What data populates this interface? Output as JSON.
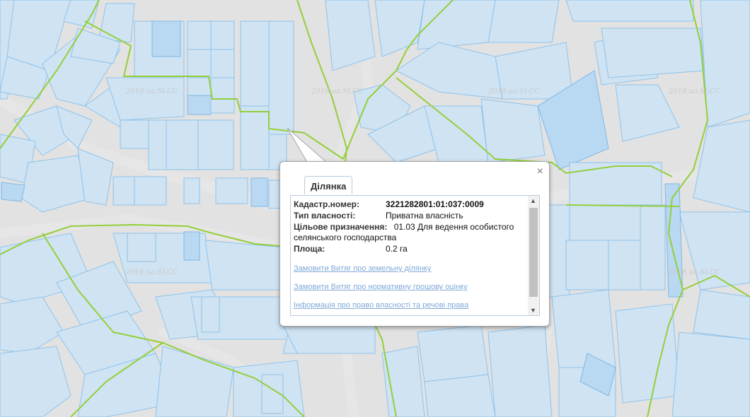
{
  "map": {
    "watermark": "2018.ua.SLCC",
    "colors": {
      "parcel": "#cfe3f3",
      "parcel_border": "#8fc3ea",
      "boundary": "#93cf3a",
      "background": "#e2e2e2"
    }
  },
  "popup": {
    "tab_title": "Ділянка",
    "close_icon": "×",
    "fields": {
      "cadastre_label": "Кадастр.номер:",
      "cadastre_value": "3221282801:01:037:0009",
      "ownership_label": "Тип власності:",
      "ownership_value": "Приватна власність",
      "purpose_label": "Цільове призначення:",
      "purpose_value": "01.03 Для ведення особистого селянського господарства",
      "area_label": "Площа:",
      "area_value": "0.2 га"
    },
    "links": {
      "extract_land": "Замовити Витяг про земельну ділянку",
      "extract_valuation": "Замовити Витяг про нормативну грошову оцінку",
      "ownership_info": "Інформація про право власності та речові права"
    }
  }
}
